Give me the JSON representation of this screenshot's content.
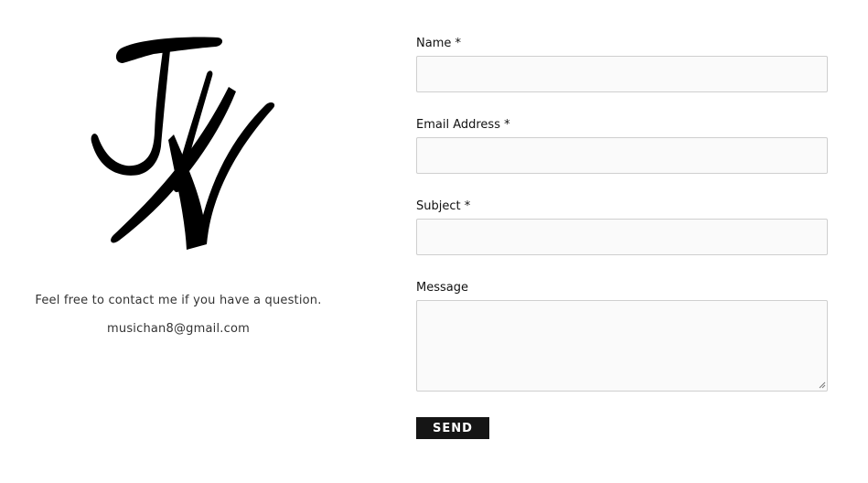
{
  "logo": {
    "icon": "jw-signature-logo",
    "color": "#000000"
  },
  "contact": {
    "message": "Feel free to contact me if you have a question.",
    "email": "musichan8@gmail.com"
  },
  "form": {
    "fields": [
      {
        "label": "Name *",
        "value": "",
        "placeholder": ""
      },
      {
        "label": "Email Address *",
        "value": "",
        "placeholder": ""
      },
      {
        "label": "Subject *",
        "value": "",
        "placeholder": ""
      },
      {
        "label": "Message",
        "value": "",
        "placeholder": ""
      }
    ],
    "send_label": "SEND",
    "field_bg": "#fafafa",
    "button_bg": "#151515"
  }
}
